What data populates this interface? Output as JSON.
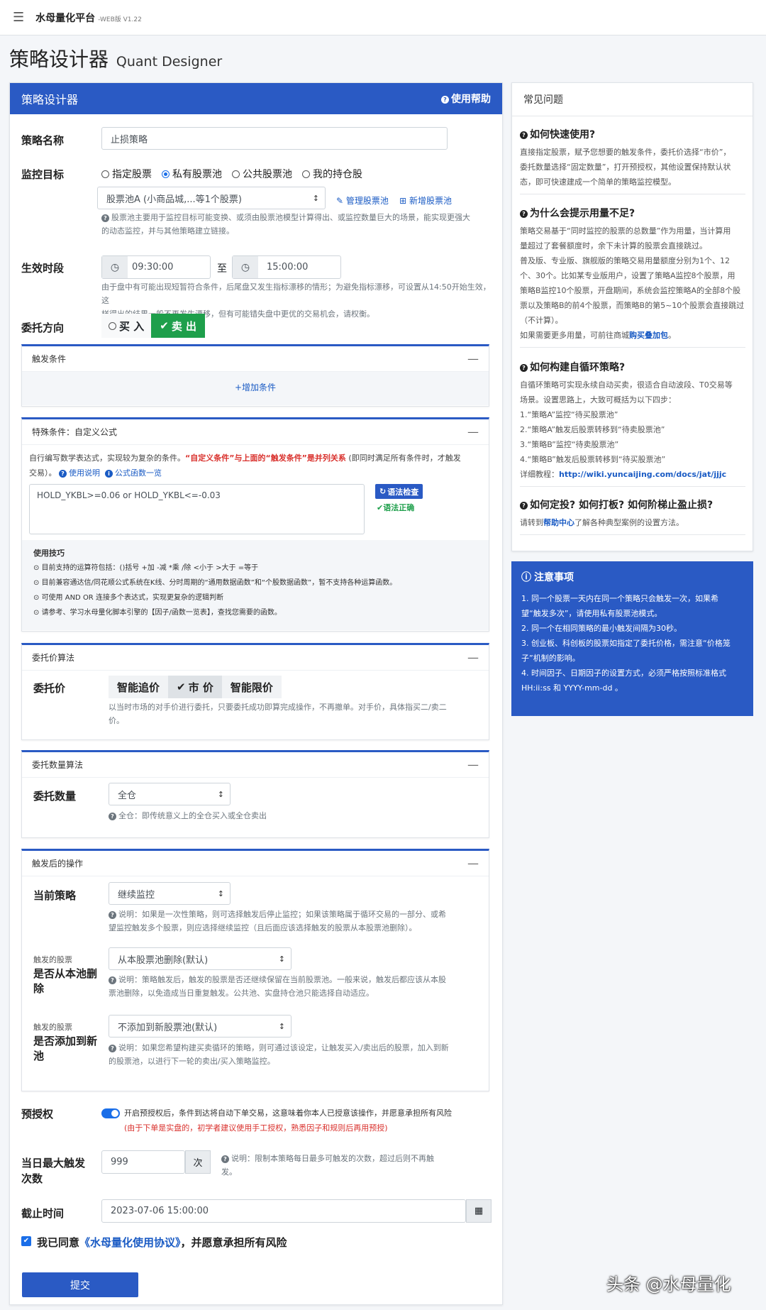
{
  "topbar": {
    "brand": "水母量化平台",
    "version": "-WEB版 V1.22"
  },
  "page": {
    "title": "策略设计器",
    "title_en": "Quant Designer"
  },
  "form": {
    "header": "策略设计器",
    "help": "使用帮助",
    "name_label": "策略名称",
    "name_value": "止损策略",
    "target_label": "监控目标",
    "target_options": [
      "指定股票",
      "私有股票池",
      "公共股票池",
      "我的持仓股"
    ],
    "pool_select": "股票池A (小商品城,...等1个股票)",
    "manage_pool": "管理股票池",
    "new_pool": "新增股票池",
    "pool_help1": "股票池主要用于监控目标可能变换、或须由股票池模型计算得出、或监控数量巨大的场景，能实现更强大",
    "pool_help2": "的动态监控，并与其他策略建立链接。",
    "time_label": "生效时段",
    "time_start": "09:30:00",
    "time_to": "至",
    "time_end": "15:00:00",
    "time_help1": "由于盘中有可能出现短暂符合条件，后尾盘又发生指标漂移的情形；为避免指标漂移，可设置从14:50开始生效，这",
    "time_help2": "样得出的结果一般不再发生漂移，但有可能错失盘中更优的交易机会，请权衡。",
    "dir_label": "委托方向",
    "dir_buy": "买 入",
    "dir_sell": "卖 出",
    "trigger_title": "触发条件",
    "add_cond": "增加条件",
    "special_title": "特殊条件：自定义公式",
    "special_desc_a": "自行编写数学表达式，实现较为复杂的条件。",
    "special_desc_red": "“自定义条件”与上面的“触发条件”是并列关系",
    "special_desc_b": "(即同时满足所有条件时，才触发",
    "special_desc_c": "交易）。",
    "usage_link": "使用说明",
    "func_link": "公式函数一览",
    "formula": "HOLD_YKBL>=0.06 or  HOLD_YKBL<=-0.03",
    "syntax_check": "语法检查",
    "syntax_ok": "语法正确",
    "tips_title": "使用技巧",
    "tips": [
      "目前支持的运算符包括：()括号 +加 -减 *乘 /除 <小于 >大于 =等于",
      "目前兼容通达信/同花顺公式系统在K线、分时周期的“通用数据函数”和“个股数据函数”，暂不支持各种运算函数。",
      "可使用 AND OR 连接多个表达式，实现更复杂的逻辑判断",
      "请参考、学习水母量化脚本引擎的【因子/函数一览表】，查找您需要的函数。"
    ],
    "price_algo_title": "委托价算法",
    "price_label": "委托价",
    "price_opts": [
      "智能追价",
      "市 价",
      "智能限价"
    ],
    "price_help1": "以当时市场的对手价进行委托，只要委托成功即算完成操作，不再撤单。对手价，具体指买二/卖二",
    "price_help2": "价。",
    "qty_algo_title": "委托数量算法",
    "qty_label": "委托数量",
    "qty_value": "全仓",
    "qty_help": "全仓：即传统意义上的全仓买入或全仓卖出",
    "after_title": "触发后的操作",
    "cur_strategy_label": "当前策略",
    "cur_strategy_value": "继续监控",
    "cur_help1": "说明：如果是一次性策略，则可选择触发后停止监控；如果该策略属于循环交易的一部分、或希",
    "cur_help2": "望监控触发多个股票，则应选择继续监控（且后面应该选择触发的股票从本股票池删除）。",
    "remove_small": "触发的股票",
    "remove_label1": "是否从本池删",
    "remove_label2": "除",
    "remove_value": "从本股票池删除(默认)",
    "remove_help1": "说明：策略触发后，触发的股票是否还继续保留在当前股票池。一般来说，触发后都应该从本股",
    "remove_help2": "票池删除，以免造成当日重复触发。公共池、实盘持仓池只能选择自动适应。",
    "add_small": "触发的股票",
    "add_label1": "是否添加到新",
    "add_label2": "池",
    "add_value": "不添加到新股票池(默认)",
    "add_help1": "说明：如果您希望构建买卖循环的策略，则可通过该设定，让触发买入/卖出后的股票，加入到新",
    "add_help2": "的股票池，以进行下一轮的卖出/买入策略监控。",
    "preauth_label": "预授权",
    "preauth_text": "开启预授权后，条件到达将自动下单交易，这意味着你本人已授意该操作，并愿意承担所有风险",
    "preauth_red": "(由于下单是实盘的，初学者建议使用手工授权，熟悉因子和规则后再用预授)",
    "max_label1": "当日最大触发",
    "max_label2": "次数",
    "max_value": "999",
    "max_unit": "次",
    "max_help1": "说明：限制本策略每日最多可触发的次数，超过后则不再触",
    "max_help2": "发。",
    "deadline_label": "截止时间",
    "deadline_value": "2023-07-06 15:00:00",
    "agree_a": "我已同意",
    "agree_link": "《水母量化使用协议》",
    "agree_b": "，并愿意承担所有风险",
    "submit": "提交"
  },
  "faq": {
    "header": "常见问题",
    "q1": "如何快速使用?",
    "a1": [
      "直接指定股票，赋予您想要的触发条件，委托价选择“市价”，",
      "委托数量选择“固定数量”，打开预授权，其他设置保持默认状",
      "态，即可快速建成一个简单的策略监控模型。"
    ],
    "q2": "为什么会提示用量不足?",
    "a2": [
      "策略交易基于“同时监控的股票的总数量”作为用量，当计算用",
      "量超过了套餐额度时，余下未计算的股票会直接跳过。",
      "普及版、专业版、旗舰版的策略交易用量额度分别为1个、12",
      "个、30个。比如某专业版用户，设置了策略A监控8个股票，用",
      "策略B监控10个股票，开盘期间，系统会监控策略A的全部8个股",
      "票以及策略B的前4个股票，而策略B的第5~10个股票会直接跳过",
      "（不计算）。"
    ],
    "a2_more": "如果需要更多用量，可前往商城",
    "a2_link": "购买叠加包",
    "q3": "如何构建自循环策略?",
    "a3": [
      "自循环策略可实现永续自动买卖，很适合自动波段、T0交易等",
      "场景。设置思路上，大致可概括为以下四步：",
      "1.“策略A”监控“待买股票池”",
      "2.“策略A”触发后股票转移到“待卖股票池”",
      "3.“策略B”监控“待卖股票池”",
      "4.“策略B”触发后股票转移到“待买股票池”"
    ],
    "a3_tut": "详细教程：",
    "a3_url": "http://wiki.yuncaijing.com/docs/jat/jjjc",
    "q4": "如何定投? 如何打板? 如何阶梯止盈止损?",
    "a4_a": "请转到",
    "a4_link": "帮助中心",
    "a4_b": "了解各种典型案例的设置方法。"
  },
  "notes": {
    "title": "注意事项",
    "items": [
      "1. 同一个股票一天内在同一个策略只会触发一次，如果希",
      "望“触发多次”，请使用私有股票池模式。",
      "2. 同一个在相同策略的最小触发间隔为30秒。",
      "3. 创业板、科创板的股票如指定了委托价格，需注意“价格笼",
      "子”机制的影响。",
      "4. 时间因子、日期因子的设置方式，必须严格按照标准格式",
      "HH:ii:ss 和 YYYY-mm-dd 。"
    ]
  },
  "watermark": "头条 @水母量化"
}
